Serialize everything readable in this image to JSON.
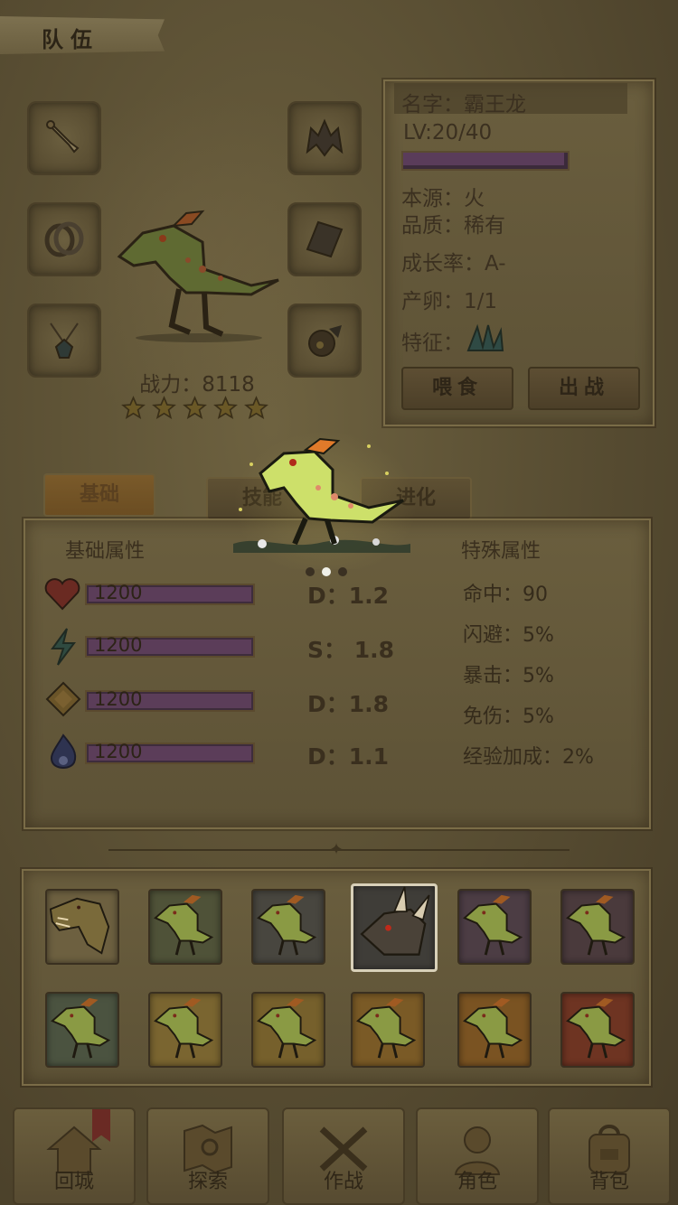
{
  "header": {
    "title": "队伍"
  },
  "dino": {
    "name": "名字：霸王龙",
    "level": "LV:20/40",
    "level_progress": 0.5,
    "origin": "本源：火",
    "quality": "品质：稀有",
    "growth": "成长率：A-",
    "eggs": "产卵：1/1",
    "trait_label": "特征：",
    "power": "战力：8118",
    "stars": 5
  },
  "actions": {
    "feed": "喂食",
    "battle": "出战"
  },
  "tabs": [
    {
      "label": "基础"
    },
    {
      "label": "技能"
    },
    {
      "label": "进化"
    }
  ],
  "attributes": {
    "basic_title": "基础属性",
    "special_title": "特殊属性",
    "bars": [
      {
        "icon": "heart-icon",
        "value": "1200",
        "grade": "D：1.2"
      },
      {
        "icon": "lightning-icon",
        "value": "1200",
        "grade": "S： 1.8"
      },
      {
        "icon": "shield-icon",
        "value": "1200",
        "grade": "D：1.8"
      },
      {
        "icon": "flame-icon",
        "value": "1200",
        "grade": "D：1.1"
      }
    ],
    "special": [
      "命中：90",
      "闪避：5%",
      "暴击：5%",
      "免伤：5%",
      "经验加成：2%"
    ]
  },
  "carousel": {
    "pages": 3,
    "active": 1
  },
  "roster": {
    "rows": [
      [
        {
          "color": "#6d6040",
          "kind": "trex"
        },
        {
          "color": "#4f5238",
          "kind": "raptor"
        },
        {
          "color": "#48463f",
          "kind": "raptor"
        },
        {
          "color": "#3f3d38",
          "kind": "triceratops",
          "selected": true
        },
        {
          "color": "#4c3d44",
          "kind": "raptor"
        },
        {
          "color": "#4a3a3c",
          "kind": "raptor"
        }
      ],
      [
        {
          "color": "#4b5340",
          "kind": "raptor"
        },
        {
          "color": "#7a6530",
          "kind": "raptor"
        },
        {
          "color": "#76602c",
          "kind": "raptor"
        },
        {
          "color": "#7a5a26",
          "kind": "raptor"
        },
        {
          "color": "#7a5322",
          "kind": "raptor"
        },
        {
          "color": "#6e3422",
          "kind": "raptor"
        }
      ]
    ]
  },
  "nav": [
    {
      "label": "回城",
      "icon": "home-icon"
    },
    {
      "label": "探索",
      "icon": "map-icon"
    },
    {
      "label": "作战",
      "icon": "swords-icon"
    },
    {
      "label": "角色",
      "icon": "character-icon"
    },
    {
      "label": "背包",
      "icon": "backpack-icon"
    }
  ],
  "colors": {
    "bar_fill": "#5b3d59",
    "accent_tab": "#7a5a2a"
  }
}
